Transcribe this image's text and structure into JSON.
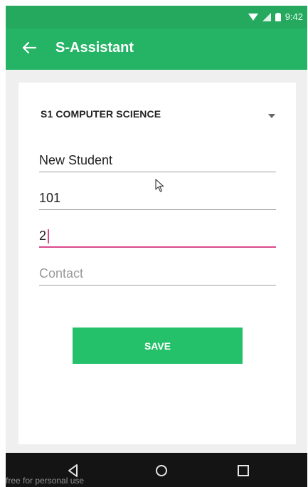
{
  "status_bar": {
    "time": "9:42",
    "icons": [
      "wifi-icon",
      "signal-icon",
      "battery-icon"
    ]
  },
  "app_bar": {
    "title": "S-Assistant",
    "back_icon": "arrow-back-icon",
    "color": "#25b466"
  },
  "form": {
    "class_select": {
      "selected": "S1 COMPUTER SCIENCE"
    },
    "name_field": {
      "value": "New Student"
    },
    "roll_field": {
      "value": "101"
    },
    "third_field": {
      "value": "2"
    },
    "contact_field": {
      "placeholder": "Contact"
    },
    "save_button": {
      "label": "SAVE",
      "color": "#25c16a"
    }
  },
  "nav_bar": {
    "icons": [
      "back-nav-icon",
      "home-nav-icon",
      "recents-nav-icon"
    ]
  },
  "watermark": "free for personal use"
}
